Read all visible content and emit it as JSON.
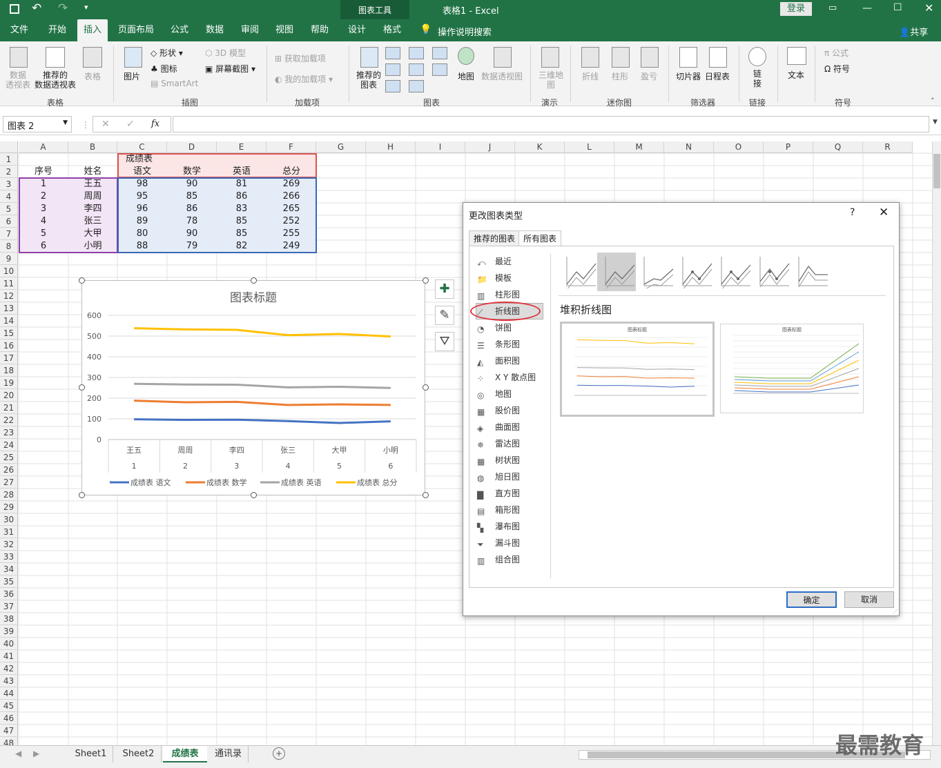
{
  "window": {
    "context_tool": "图表工具",
    "doc_title": "表格1  -  Excel",
    "login_button": "登录",
    "qat": [
      "save-icon",
      "undo-icon",
      "redo-icon"
    ]
  },
  "ribbon_tabs": [
    {
      "label": "文件"
    },
    {
      "label": "开始"
    },
    {
      "label": "插入",
      "active": true
    },
    {
      "label": "页面布局"
    },
    {
      "label": "公式"
    },
    {
      "label": "数据"
    },
    {
      "label": "审阅"
    },
    {
      "label": "视图"
    },
    {
      "label": "帮助"
    },
    {
      "label": "设计"
    },
    {
      "label": "格式"
    }
  ],
  "tell_me": "操作说明搜索",
  "share": "共享",
  "ribbon": {
    "tables": {
      "pivot": "数据\n透视表",
      "recommended_pivot": "推荐的\n数据透视表",
      "table": "表格",
      "group": "表格"
    },
    "illustrations": {
      "pictures": "图片",
      "shapes": "形状",
      "icons": "图标",
      "model3d": "3D 模型",
      "smartart": "SmartArt",
      "screenshot": "屏幕截图",
      "group": "插图"
    },
    "addins": {
      "get": "获取加载项",
      "my": "我的加载项",
      "group": "加载项"
    },
    "charts": {
      "recommended": "推荐的\n图表",
      "maps": "地图",
      "pivotchart": "数据透视图",
      "group": "图表"
    },
    "tours": {
      "map3d": "三维地\n图",
      "group": "演示"
    },
    "sparklines": {
      "line": "折线",
      "column": "柱形",
      "winloss": "盈亏",
      "group": "迷你图"
    },
    "filters": {
      "slicer": "切片器",
      "timeline": "日程表",
      "group": "筛选器"
    },
    "links": {
      "link": "链\n接",
      "group": "链接"
    },
    "text": {
      "text": "文本"
    },
    "symbols": {
      "equation": "公式",
      "symbol": "符号",
      "group": "符号"
    }
  },
  "formula_bar": {
    "name_box": "图表 2",
    "fx": "fx",
    "value": ""
  },
  "columns": [
    "A",
    "B",
    "C",
    "D",
    "E",
    "F",
    "G",
    "H",
    "I",
    "J",
    "K",
    "L",
    "M",
    "N",
    "O",
    "P",
    "Q",
    "R"
  ],
  "rows": [
    "1",
    "2",
    "3",
    "4",
    "5",
    "6",
    "7",
    "8",
    "9",
    "10",
    "11",
    "12",
    "13",
    "14",
    "15",
    "16",
    "17",
    "18",
    "19",
    "20",
    "21",
    "22",
    "23",
    "24",
    "25",
    "26",
    "27",
    "28",
    "29",
    "30",
    "31",
    "32",
    "33",
    "34",
    "35",
    "36",
    "37",
    "38",
    "39",
    "40",
    "41",
    "42",
    "43",
    "44",
    "45",
    "46",
    "47",
    "48"
  ],
  "table": {
    "merged_header": "成绩表",
    "headers": [
      "序号",
      "姓名",
      "语文",
      "数学",
      "英语",
      "总分"
    ],
    "rows": [
      [
        "1",
        "王五",
        "98",
        "90",
        "81",
        "269"
      ],
      [
        "2",
        "周周",
        "95",
        "85",
        "86",
        "266"
      ],
      [
        "3",
        "李四",
        "96",
        "86",
        "83",
        "265"
      ],
      [
        "4",
        "张三",
        "89",
        "78",
        "85",
        "252"
      ],
      [
        "5",
        "大甲",
        "80",
        "90",
        "85",
        "255"
      ],
      [
        "6",
        "小明",
        "88",
        "79",
        "82",
        "249"
      ]
    ]
  },
  "chart_data": {
    "type": "line",
    "title": "图表标题",
    "categories": [
      "王五",
      "周周",
      "李四",
      "张三",
      "大甲",
      "小明"
    ],
    "category_numbers": [
      "1",
      "2",
      "3",
      "4",
      "5",
      "6"
    ],
    "ylim": [
      0,
      600
    ],
    "yticks": [
      "600",
      "500",
      "400",
      "300",
      "200",
      "100",
      "0"
    ],
    "grid": true,
    "legend_position": "bottom",
    "series": [
      {
        "name": "成绩表 语文",
        "color": "#4472c4",
        "values": [
          98,
          95,
          96,
          89,
          80,
          88
        ]
      },
      {
        "name": "成绩表 数学",
        "color": "#ed7d31",
        "values": [
          188,
          180,
          182,
          167,
          170,
          167
        ]
      },
      {
        "name": "成绩表 英语",
        "color": "#a5a5a5",
        "values": [
          269,
          266,
          265,
          252,
          255,
          249
        ]
      },
      {
        "name": "成绩表 总分",
        "color": "#ffc000",
        "values": [
          538,
          532,
          530,
          504,
          510,
          498
        ]
      }
    ]
  },
  "dialog": {
    "title": "更改图表类型",
    "help": "?",
    "tabs": [
      "推荐的图表",
      "所有图表"
    ],
    "categories": [
      "最近",
      "模板",
      "柱形图",
      "折线图",
      "饼图",
      "条形图",
      "面积图",
      "X Y 散点图",
      "地图",
      "股价图",
      "曲面图",
      "雷达图",
      "树状图",
      "旭日图",
      "直方图",
      "箱形图",
      "瀑布图",
      "漏斗图",
      "组合图"
    ],
    "selected_category": "折线图",
    "subtype_heading": "堆积折线图",
    "preview_title": "图表标题",
    "ok": "确定",
    "cancel": "取消"
  },
  "sheets": [
    "Sheet1",
    "Sheet2",
    "成绩表",
    "通讯录"
  ],
  "active_sheet": "成绩表",
  "watermark": "最需教育"
}
